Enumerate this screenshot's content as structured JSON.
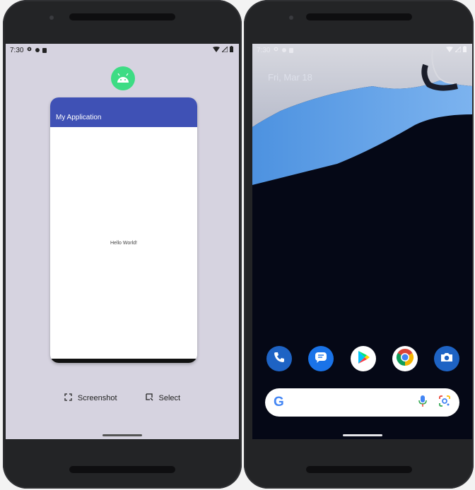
{
  "left_device": {
    "status": {
      "time": "7:30"
    },
    "app_title": "My Application",
    "content_text": "Hello World!",
    "actions": [
      {
        "label": "Screenshot",
        "icon": "screenshot-icon"
      },
      {
        "label": "Select",
        "icon": "select-icon"
      }
    ]
  },
  "right_device": {
    "status": {
      "time": "7:30"
    },
    "date": "Fri, Mar 18",
    "dock": [
      {
        "name": "Phone",
        "icon": "phone-icon",
        "color": "#1e63c4"
      },
      {
        "name": "Messages",
        "icon": "messages-icon",
        "color": "#1a73e8"
      },
      {
        "name": "Play Store",
        "icon": "play-store-icon",
        "color": "#ffffff"
      },
      {
        "name": "Chrome",
        "icon": "chrome-icon",
        "color": "#ffffff"
      },
      {
        "name": "Camera",
        "icon": "camera-icon",
        "color": "#1e63c4"
      }
    ],
    "search": {
      "logo": "G"
    }
  },
  "colors": {
    "app_bar": "#3f51b5",
    "left_background": "#d6d3e0",
    "android_green": "#3ddc84",
    "wallpaper_blue": "#5aa0e6"
  }
}
